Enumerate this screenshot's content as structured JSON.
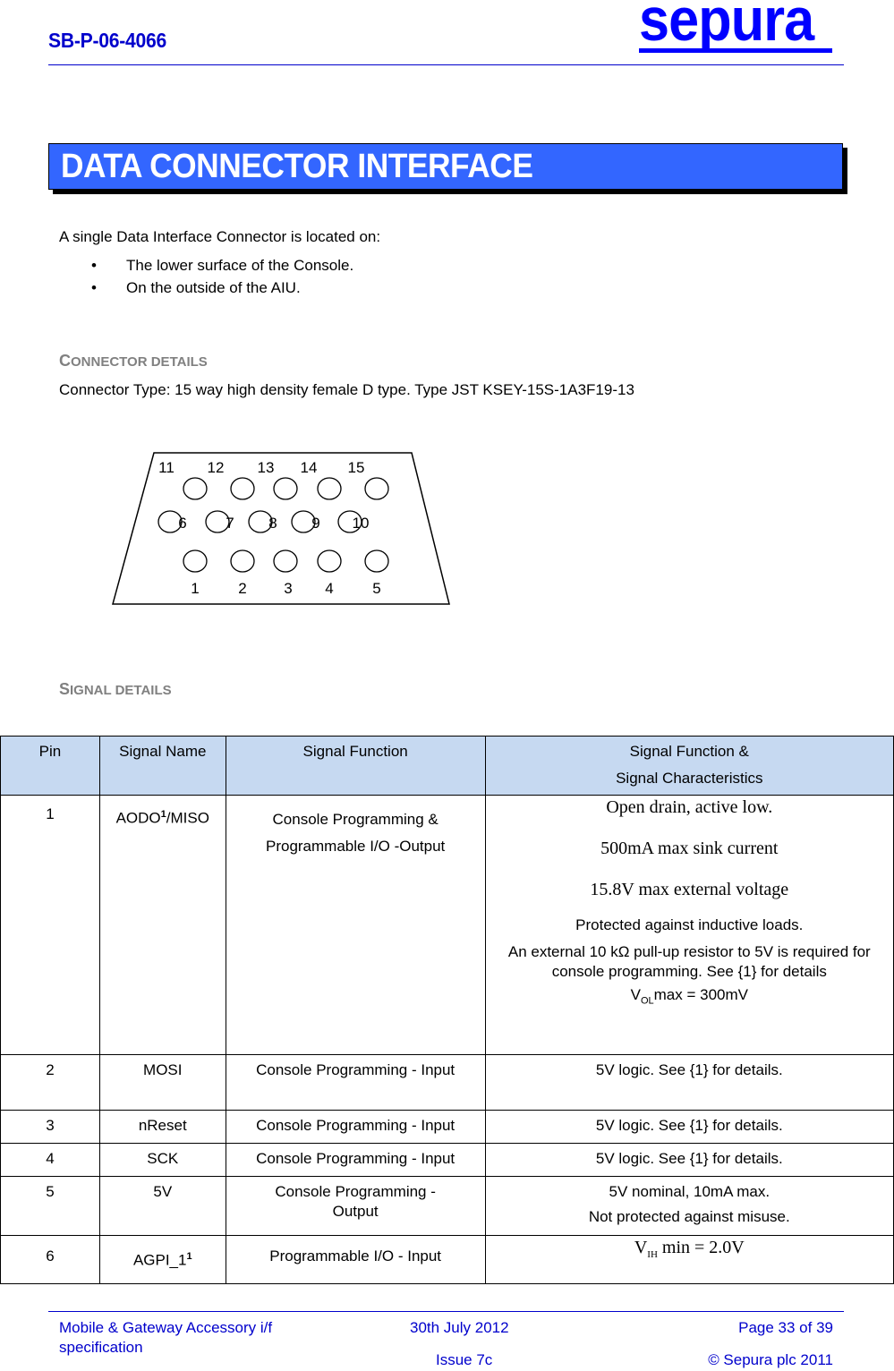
{
  "header": {
    "doc_id": "SB-P-06-4066",
    "logo_text": "sepura",
    "brand_color": "#0000ff"
  },
  "title": {
    "text": "DATA CONNECTOR INTERFACE",
    "background": "#3366ff"
  },
  "intro": {
    "text": "A single Data Interface Connector is located on:",
    "bullets": [
      "The lower surface of the Console.",
      "On the outside of the AIU."
    ]
  },
  "connector_details": {
    "heading_cap": "C",
    "heading_rest": "ONNECTOR DETAILS",
    "type_text": "Connector Type:  15 way high density female D type. Type JST KSEY-15S-1A3F19-13"
  },
  "connector_diagram": {
    "top_row": [
      "11",
      "12",
      "13",
      "14",
      "15"
    ],
    "middle_row": [
      "6",
      "7",
      "8",
      "9",
      "10"
    ],
    "bottom_row": [
      "1",
      "2",
      "3",
      "4",
      "5"
    ]
  },
  "signal_details": {
    "heading_cap": "S",
    "heading_rest": "IGNAL DETAILS",
    "columns": [
      "Pin",
      "Signal Name",
      "Signal Function",
      "Signal Function &",
      "Signal Characteristics"
    ],
    "header_color": "#c6d9f1",
    "rows": [
      {
        "pin": "1",
        "name": "AODO",
        "name_sup": "1",
        "name_suffix": "/MISO",
        "function": "Console Programming & Programmable I/O -Output",
        "char_serif": [
          "Open drain, active low.",
          "500mA max sink current",
          "15.8V max external voltage"
        ],
        "char_sans": [
          "Protected against inductive loads.",
          "An external 10 kΩ pull-up resistor to 5V is required for console programming.  See {1} for details"
        ],
        "char_vol_prefix": "V",
        "char_vol_sub": "OL",
        "char_vol_suffix": "max = 300mV"
      },
      {
        "pin": "2",
        "name": "MOSI",
        "function": "Console Programming  - Input",
        "char": "5V logic.  See {1} for details."
      },
      {
        "pin": "3",
        "name": "nReset",
        "function": "Console Programming - Input",
        "char": "5V logic.  See {1} for details."
      },
      {
        "pin": "4",
        "name": "SCK",
        "function": "Console Programming - Input",
        "char": "5V logic.  See {1} for details."
      },
      {
        "pin": "5",
        "name": "5V",
        "function": "Console Programming - Output",
        "char_lines": [
          "5V nominal, 10mA max.",
          "Not protected against misuse."
        ]
      },
      {
        "pin": "6",
        "name": "AGPI_1",
        "name_sup": "1",
        "function": "Programmable I/O - Input",
        "char_vih_prefix": "V",
        "char_vih_sub": "IH",
        "char_vih_suffix": " min = 2.0V"
      }
    ]
  },
  "footer": {
    "doc_title_line1": "Mobile & Gateway Accessory i/f",
    "doc_title_line2": "specification",
    "date": "30th July 2012",
    "issue": "Issue 7c",
    "page": "Page 33 of 39",
    "copyright": "© Sepura plc 2011"
  }
}
